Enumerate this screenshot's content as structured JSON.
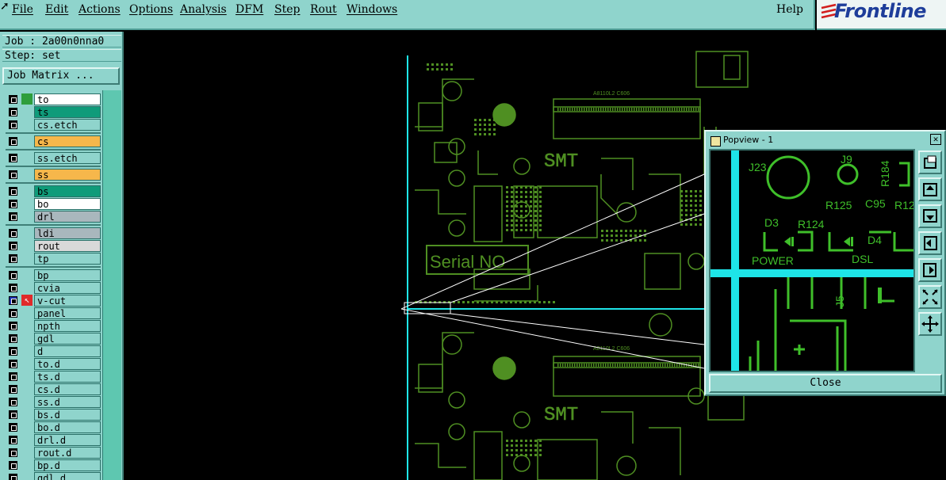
{
  "menu": {
    "items": [
      "File",
      "Edit",
      "Actions",
      "Options",
      "Analysis",
      "DFM",
      "Step",
      "Rout",
      "Windows"
    ],
    "help": "Help",
    "logo": "Frontline"
  },
  "job": {
    "job_line": "Job : 2a00n0nna0",
    "step_line": "Step: set",
    "matrix_button": "Job Matrix ..."
  },
  "layers": [
    {
      "name": "to",
      "color": "#2e9e3c",
      "bg": "#ffffff"
    },
    {
      "name": "ts",
      "color": "",
      "bg": "#0f9b7a"
    },
    {
      "name": "cs.etch",
      "color": "",
      "bg": "#8fd4cc"
    },
    {
      "name": "cs",
      "color": "",
      "bg": "#f6b74b"
    },
    {
      "name": "ss.etch",
      "color": "",
      "bg": "#8fd4cc"
    },
    {
      "name": "ss",
      "color": "",
      "bg": "#f6b74b"
    },
    {
      "name": "bs",
      "color": "",
      "bg": "#0f9b7a"
    },
    {
      "name": "bo",
      "color": "",
      "bg": "#ffffff"
    },
    {
      "name": "drl",
      "color": "",
      "bg": "#a9b7bd"
    },
    {
      "name": "ldi",
      "color": "",
      "bg": "#a9b7bd"
    },
    {
      "name": "rout",
      "color": "",
      "bg": "#d9d9d9"
    },
    {
      "name": "tp",
      "color": "",
      "bg": "#8fd4cc"
    },
    {
      "name": "bp",
      "color": "",
      "bg": "#8fd4cc"
    },
    {
      "name": "cvia",
      "color": "",
      "bg": "#8fd4cc"
    },
    {
      "name": "v-cut",
      "color": "",
      "bg": "#8fd4cc"
    },
    {
      "name": "panel",
      "color": "",
      "bg": "#8fd4cc"
    },
    {
      "name": "npth",
      "color": "",
      "bg": "#8fd4cc"
    },
    {
      "name": "gdl",
      "color": "",
      "bg": "#8fd4cc"
    },
    {
      "name": "d",
      "color": "",
      "bg": "#8fd4cc"
    },
    {
      "name": "to.d",
      "color": "",
      "bg": "#8fd4cc"
    },
    {
      "name": "ts.d",
      "color": "",
      "bg": "#8fd4cc"
    },
    {
      "name": "cs.d",
      "color": "",
      "bg": "#8fd4cc"
    },
    {
      "name": "ss.d",
      "color": "",
      "bg": "#8fd4cc"
    },
    {
      "name": "bs.d",
      "color": "",
      "bg": "#8fd4cc"
    },
    {
      "name": "bo.d",
      "color": "",
      "bg": "#8fd4cc"
    },
    {
      "name": "drl.d",
      "color": "",
      "bg": "#8fd4cc"
    },
    {
      "name": "rout.d",
      "color": "",
      "bg": "#8fd4cc"
    },
    {
      "name": "bp.d",
      "color": "",
      "bg": "#8fd4cc"
    },
    {
      "name": "gdl.d",
      "color": "",
      "bg": "#8fd4cc"
    }
  ],
  "board": {
    "serial_label": "Serial NO",
    "smt_label": "SMT",
    "chip_label": "A8110L2 C606"
  },
  "popview": {
    "title": "Popview - 1",
    "close_button": "Close",
    "refs": {
      "j23": "J23",
      "j9": "J9",
      "r184": "R184",
      "r125": "R125",
      "c95": "C95",
      "r12": "R12",
      "d3": "D3",
      "r124": "R124",
      "d4": "D4",
      "power": "POWER",
      "dsl": "DSL",
      "j5": "J5"
    }
  },
  "colors": {
    "ui_bg": "#8fd4cc",
    "trace": "#4f8f22",
    "cyan": "#1ee5e8",
    "popview_trace": "#3fbf2a"
  }
}
